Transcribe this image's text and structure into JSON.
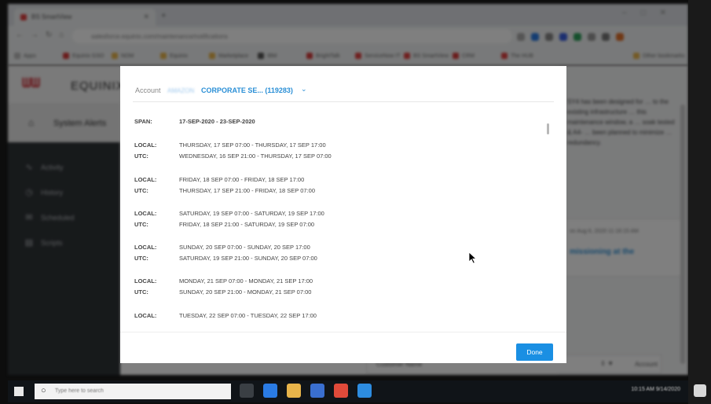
{
  "browser": {
    "tab_title": "BS SmartView",
    "url": "salesforce.equinix.com/maintenance/notifications",
    "bookmarks": [
      "Apps",
      "Equinix GSO",
      "NOM",
      "Equinix",
      "Marketplace",
      "IBM",
      "BrightTalk",
      "ServiceNow IT",
      "BS SmartView",
      "CRM",
      "The HUB",
      "Other bookmarks"
    ]
  },
  "page": {
    "logo": "EQUINIX",
    "logo_mark": "ᗯᗯ",
    "system_alerts": "System Alerts",
    "nav": [
      {
        "label": "Activity",
        "icon": "activity-icon",
        "glyph": "∿"
      },
      {
        "label": "History",
        "icon": "history-icon",
        "glyph": "◷"
      },
      {
        "label": "Scheduled",
        "icon": "mail-icon",
        "glyph": "✉"
      },
      {
        "label": "Scripts",
        "icon": "document-icon",
        "glyph": "▤"
      }
    ],
    "right_text": "SY4 has been designed for … to the existing infrastructure … this maintenance window, a … soak tested & A4- … been planned to minimize … redundancy.",
    "right_date": "on Aug 6, 2020 11:16:15 AM",
    "right_link": "missioning at the",
    "filter_col": "Customer Name",
    "filter_col2": "Account"
  },
  "modal": {
    "account_label": "Account",
    "account_name": "CORPORATE SE... (119283)",
    "account_blurred": "AMAZON",
    "span_key": "SPAN:",
    "span_value": "17-SEP-2020 - 23-SEP-2020",
    "schedule": [
      {
        "local": "THURSDAY, 17 SEP 07:00 - THURSDAY, 17 SEP 17:00",
        "utc": "WEDNESDAY, 16 SEP 21:00 - THURSDAY, 17 SEP 07:00"
      },
      {
        "local": "FRIDAY, 18 SEP 07:00 - FRIDAY, 18 SEP 17:00",
        "utc": "THURSDAY, 17 SEP 21:00 - FRIDAY, 18 SEP 07:00"
      },
      {
        "local": "SATURDAY, 19 SEP 07:00 - SATURDAY, 19 SEP 17:00",
        "utc": "FRIDAY, 18 SEP 21:00 - SATURDAY, 19 SEP 07:00"
      },
      {
        "local": "SUNDAY, 20 SEP 07:00 - SUNDAY, 20 SEP 17:00",
        "utc": "SATURDAY, 19 SEP 21:00 - SUNDAY, 20 SEP 07:00"
      },
      {
        "local": "MONDAY, 21 SEP 07:00 - MONDAY, 21 SEP 17:00",
        "utc": "SUNDAY, 20 SEP 21:00 - MONDAY, 21 SEP 07:00"
      },
      {
        "local": "TUESDAY, 22 SEP 07:00 - TUESDAY, 22 SEP 17:00",
        "utc": null
      }
    ],
    "local_key": "LOCAL:",
    "utc_key": "UTC:",
    "done_label": "Done"
  },
  "taskbar": {
    "search_placeholder": "Type here to search",
    "clock": "10:15 AM  9/14/2020"
  },
  "colors": {
    "accent": "#1a8fe3",
    "link": "#2a8fd6",
    "sidebar": "#2f3437",
    "brand_red": "#d0202a"
  }
}
